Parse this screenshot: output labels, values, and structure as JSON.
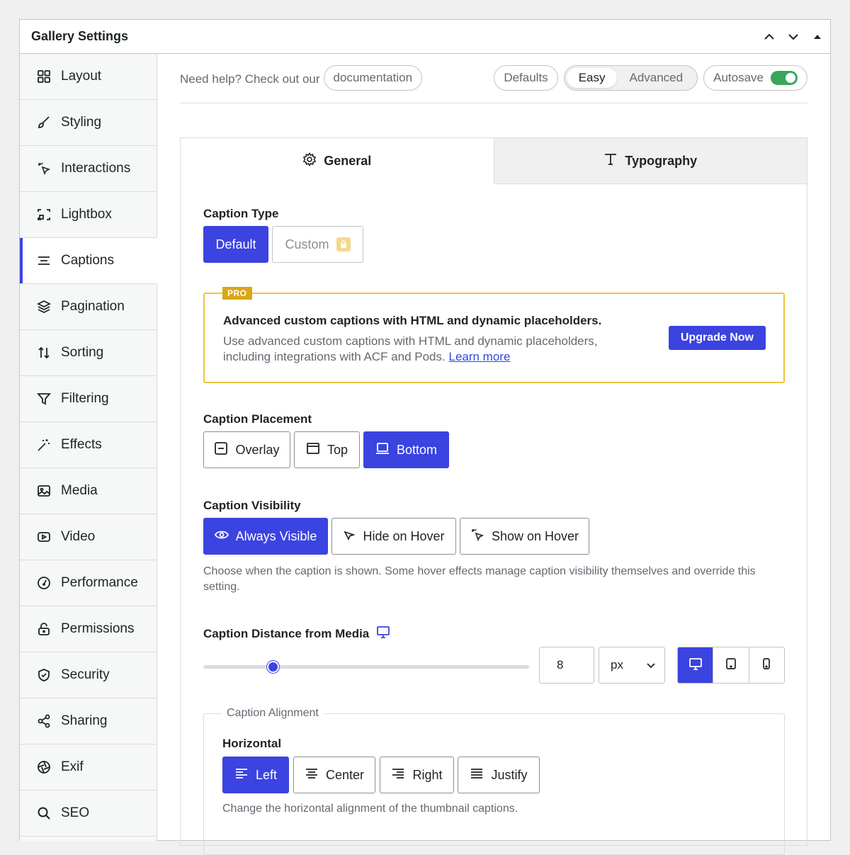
{
  "panel": {
    "title": "Gallery Settings"
  },
  "sidebar": {
    "items": [
      {
        "label": "Layout",
        "icon": "layout-icon"
      },
      {
        "label": "Styling",
        "icon": "brush-icon"
      },
      {
        "label": "Interactions",
        "icon": "pointer-click-icon"
      },
      {
        "label": "Lightbox",
        "icon": "lightbox-icon"
      },
      {
        "label": "Captions",
        "icon": "captions-icon",
        "active": true
      },
      {
        "label": "Pagination",
        "icon": "layers-icon"
      },
      {
        "label": "Sorting",
        "icon": "sort-icon"
      },
      {
        "label": "Filtering",
        "icon": "filter-icon"
      },
      {
        "label": "Effects",
        "icon": "magic-wand-icon"
      },
      {
        "label": "Media",
        "icon": "image-icon"
      },
      {
        "label": "Video",
        "icon": "video-icon"
      },
      {
        "label": "Performance",
        "icon": "gauge-icon"
      },
      {
        "label": "Permissions",
        "icon": "lock-icon"
      },
      {
        "label": "Security",
        "icon": "shield-icon"
      },
      {
        "label": "Sharing",
        "icon": "share-icon"
      },
      {
        "label": "Exif",
        "icon": "aperture-icon"
      },
      {
        "label": "SEO",
        "icon": "search-icon"
      }
    ]
  },
  "topbar": {
    "help_text": "Need help? Check out our",
    "documentation": "documentation",
    "defaults": "Defaults",
    "mode_easy": "Easy",
    "mode_advanced": "Advanced",
    "autosave": "Autosave"
  },
  "tabs": {
    "general": "General",
    "typography": "Typography"
  },
  "caption_type": {
    "label": "Caption Type",
    "default": "Default",
    "custom": "Custom"
  },
  "pro": {
    "badge": "PRO",
    "title": "Advanced custom captions with HTML and dynamic placeholders.",
    "desc": "Use advanced custom captions with HTML and dynamic placeholders, including integrations with ACF and Pods.",
    "learn_more": "Learn more",
    "upgrade": "Upgrade Now"
  },
  "placement": {
    "label": "Caption Placement",
    "overlay": "Overlay",
    "top": "Top",
    "bottom": "Bottom"
  },
  "visibility": {
    "label": "Caption Visibility",
    "always": "Always Visible",
    "hide_hover": "Hide on Hover",
    "show_hover": "Show on Hover",
    "help": "Choose when the caption is shown. Some hover effects manage caption visibility themselves and override this setting."
  },
  "distance": {
    "label": "Caption Distance from Media",
    "value": "8",
    "unit": "px"
  },
  "alignment": {
    "legend": "Caption Alignment",
    "horizontal": "Horizontal",
    "left": "Left",
    "center": "Center",
    "right": "Right",
    "justify": "Justify",
    "help": "Change the horizontal alignment of the thumbnail captions."
  },
  "colors": {
    "accent": "#3b43e0",
    "pro_border": "#f0c33c",
    "toggle_on": "#3aa65a"
  }
}
